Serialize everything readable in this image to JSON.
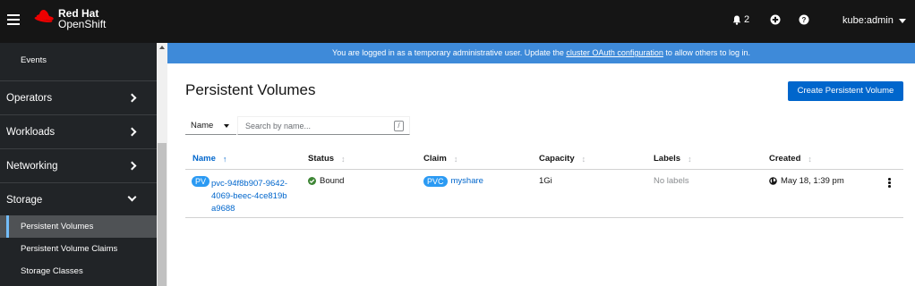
{
  "masthead": {
    "brand_line1": "Red Hat",
    "brand_line2": "OpenShift",
    "notification_count": "2",
    "user": "kube:admin"
  },
  "sidebar": {
    "top_item": "Events",
    "groups": [
      {
        "label": "Operators"
      },
      {
        "label": "Workloads"
      },
      {
        "label": "Networking"
      },
      {
        "label": "Storage"
      }
    ],
    "storage_items": [
      {
        "label": "Persistent Volumes"
      },
      {
        "label": "Persistent Volume Claims"
      },
      {
        "label": "Storage Classes"
      }
    ]
  },
  "banner": {
    "prefix": "You are logged in as a temporary administrative user. Update the ",
    "link": "cluster OAuth configuration",
    "suffix": " to allow others to log in."
  },
  "page": {
    "title": "Persistent Volumes",
    "create_button": "Create Persistent Volume"
  },
  "filter": {
    "selected": "Name",
    "placeholder": "Search by name...",
    "shortcut": "/"
  },
  "table": {
    "headers": [
      "Name",
      "Status",
      "Claim",
      "Capacity",
      "Labels",
      "Created"
    ],
    "rows": [
      {
        "name_badge": "PV",
        "name": "pvc-94f8b907-9642-4069-beec-4ce819ba9688",
        "status": "Bound",
        "claim_badge": "PVC",
        "claim": "myshare",
        "capacity": "1Gi",
        "labels": "No labels",
        "created": "May 18, 1:39 pm"
      }
    ]
  },
  "colors": {
    "masthead_bg": "#151515",
    "sidebar_bg": "#212427",
    "banner_bg": "#3e8ad9",
    "primary": "#0066cc",
    "brand_red": "#ee0000",
    "success": "#3e8635"
  }
}
